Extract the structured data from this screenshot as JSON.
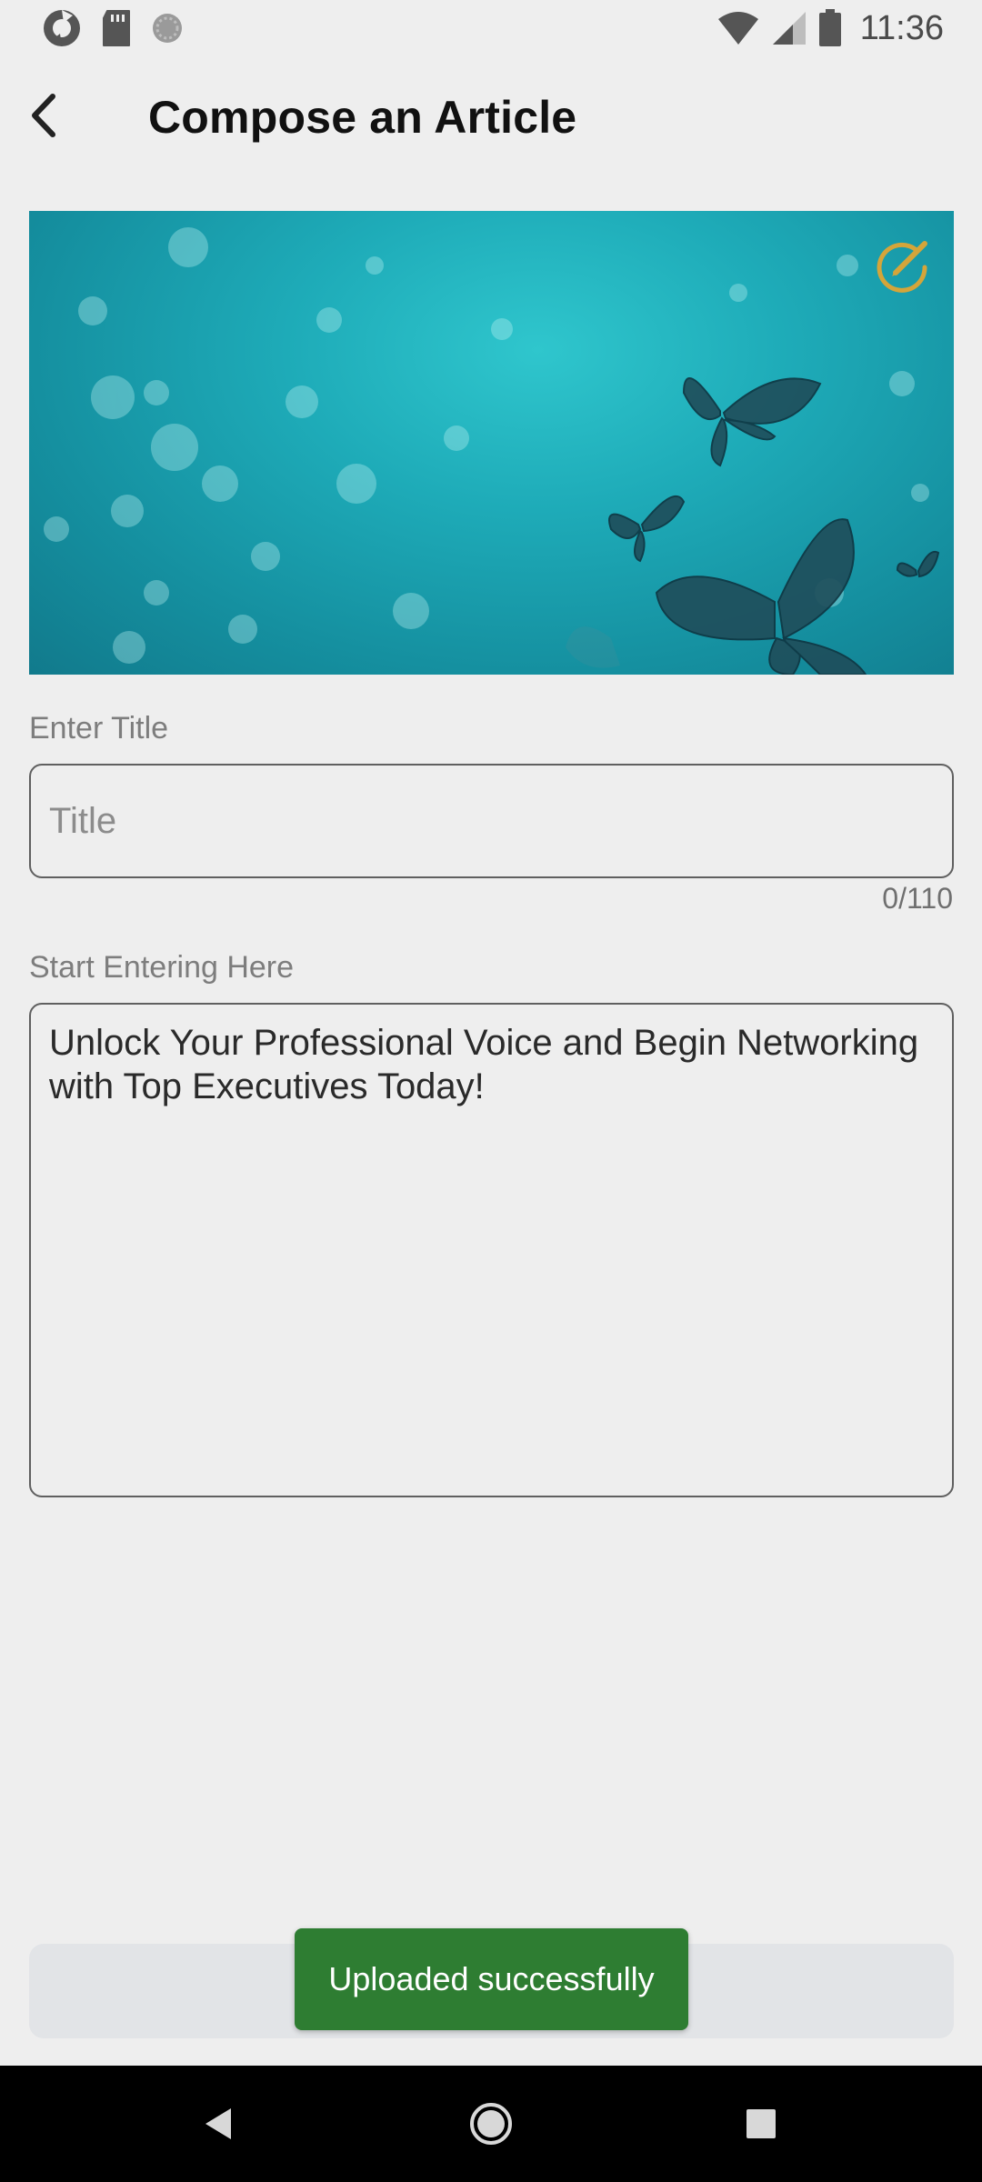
{
  "status_bar": {
    "time": "11:36",
    "left_icons": [
      "sync-app-icon",
      "sd-card-icon",
      "loading-circle-icon"
    ],
    "right_icons": [
      "wifi-icon",
      "cell-signal-icon",
      "battery-icon"
    ]
  },
  "app_bar": {
    "back_icon": "chevron-left-icon",
    "title": "Compose an Article"
  },
  "cover_image": {
    "description_icon": "butterflies-teal-cover-image",
    "edit_icon": "edit-pencil-circle-icon",
    "edit_icon_color": "#d4a53a"
  },
  "title_field": {
    "label": "Enter Title",
    "placeholder": "Title",
    "value": "",
    "counter": "0/110"
  },
  "body_field": {
    "label": "Start Entering Here",
    "value": "Unlock Your Professional Voice and Begin Networking with Top Executives Today!"
  },
  "toast": {
    "message": "Uploaded successfully",
    "color": "#2e7d32"
  },
  "nav_bar": {
    "back_icon": "nav-back-triangle-icon",
    "home_icon": "nav-home-circle-icon",
    "recents_icon": "nav-recents-square-icon"
  }
}
